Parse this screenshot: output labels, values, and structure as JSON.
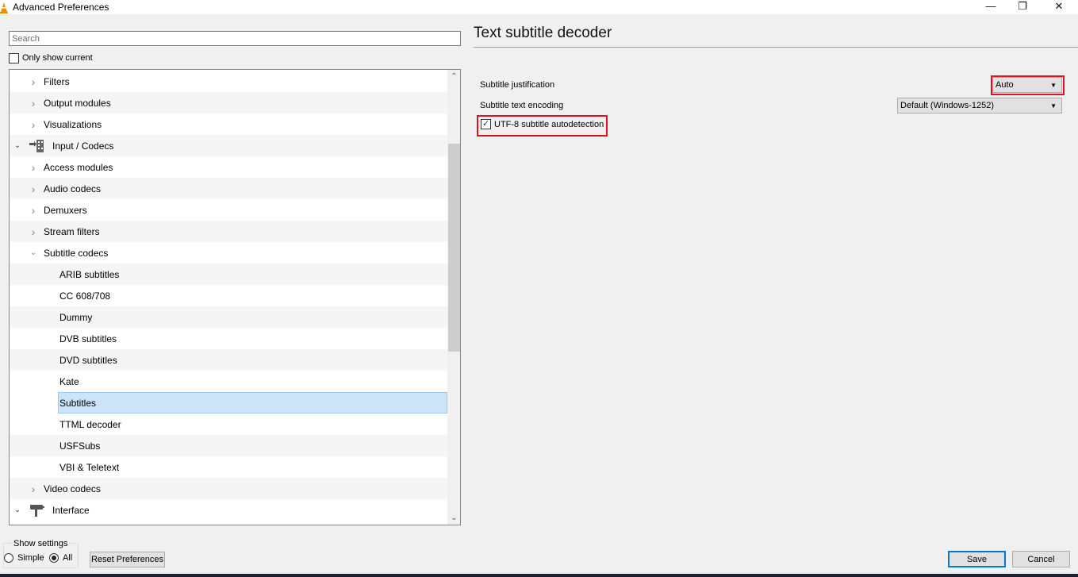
{
  "window": {
    "title": "Advanced Preferences",
    "controls": {
      "minimize": "—",
      "maximize": "❐",
      "close": "✕"
    }
  },
  "search": {
    "placeholder": "Search",
    "value": ""
  },
  "only_show_current": {
    "label": "Only show current",
    "checked": false
  },
  "tree": {
    "items": [
      {
        "label": "Filters",
        "level": 1,
        "expanded": false,
        "icon": "chevron-right-icon"
      },
      {
        "label": "Output modules",
        "level": 1,
        "expanded": false,
        "icon": "chevron-right-icon"
      },
      {
        "label": "Visualizations",
        "level": 1,
        "expanded": false,
        "icon": "chevron-right-icon"
      },
      {
        "label": "Input / Codecs",
        "level": 0,
        "expanded": true,
        "icon": "input-codecs-icon"
      },
      {
        "label": "Access modules",
        "level": 1,
        "expanded": false,
        "icon": "chevron-right-icon"
      },
      {
        "label": "Audio codecs",
        "level": 1,
        "expanded": false,
        "icon": "chevron-right-icon"
      },
      {
        "label": "Demuxers",
        "level": 1,
        "expanded": false,
        "icon": "chevron-right-icon"
      },
      {
        "label": "Stream filters",
        "level": 1,
        "expanded": false,
        "icon": "chevron-right-icon"
      },
      {
        "label": "Subtitle codecs",
        "level": 1,
        "expanded": true,
        "icon": "chevron-down-icon"
      },
      {
        "label": "ARIB subtitles",
        "level": 2
      },
      {
        "label": "CC 608/708",
        "level": 2
      },
      {
        "label": "Dummy",
        "level": 2
      },
      {
        "label": "DVB subtitles",
        "level": 2
      },
      {
        "label": "DVD subtitles",
        "level": 2
      },
      {
        "label": "Kate",
        "level": 2
      },
      {
        "label": "Subtitles",
        "level": 2,
        "selected": true
      },
      {
        "label": "TTML decoder",
        "level": 2
      },
      {
        "label": "USFSubs",
        "level": 2
      },
      {
        "label": "VBI & Teletext",
        "level": 2
      },
      {
        "label": "Video codecs",
        "level": 1,
        "expanded": false,
        "icon": "chevron-right-icon"
      },
      {
        "label": "Interface",
        "level": 0,
        "expanded": true,
        "icon": "interface-icon"
      }
    ]
  },
  "show_settings": {
    "legend": "Show settings",
    "options": [
      {
        "label": "Simple",
        "checked": false
      },
      {
        "label": "All",
        "checked": true
      }
    ]
  },
  "buttons": {
    "reset": "Reset Preferences",
    "save": "Save",
    "cancel": "Cancel"
  },
  "panel": {
    "title": "Text subtitle decoder",
    "options": {
      "justification": {
        "label": "Subtitle justification",
        "value": "Auto"
      },
      "encoding": {
        "label": "Subtitle text encoding",
        "value": "Default (Windows-1252)"
      },
      "utf8": {
        "label": "UTF-8 subtitle autodetection",
        "checked": true
      }
    }
  },
  "colors": {
    "highlight": "#e0101c",
    "selection": "#cce4f7",
    "accent": "#0078d7"
  }
}
